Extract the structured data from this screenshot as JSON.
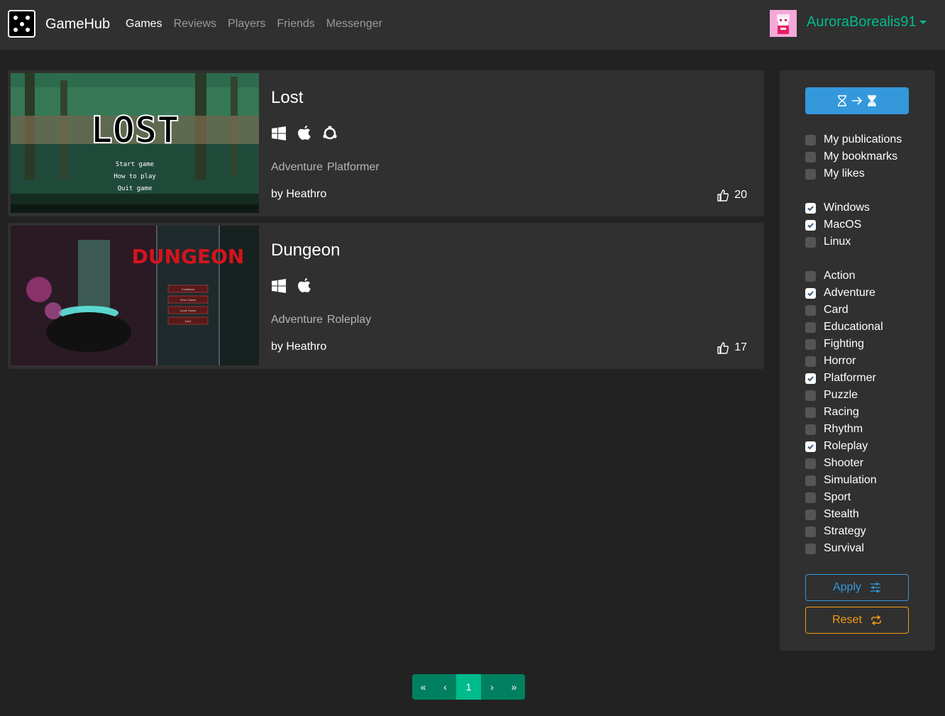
{
  "navbar": {
    "brand": "GameHub",
    "links": [
      {
        "label": "Games",
        "active": true
      },
      {
        "label": "Reviews",
        "active": false
      },
      {
        "label": "Players",
        "active": false
      },
      {
        "label": "Friends",
        "active": false
      },
      {
        "label": "Messenger",
        "active": false
      }
    ],
    "username": "AuroraBorealis91"
  },
  "games": [
    {
      "title": "Lost",
      "platforms": [
        "windows-icon",
        "apple-icon",
        "linux-icon"
      ],
      "tags": [
        "Adventure",
        "Platformer"
      ],
      "author": "by Heathro",
      "likes": "20",
      "thumb_text": "LOST",
      "thumb_menu": [
        "Start game",
        "How to play",
        "Quit game"
      ]
    },
    {
      "title": "Dungeon",
      "platforms": [
        "windows-icon",
        "apple-icon"
      ],
      "tags": [
        "Adventure",
        "Roleplay"
      ],
      "author": "by Heathro",
      "likes": "17",
      "thumb_text": "DUNGEON",
      "thumb_menu": [
        "Continue",
        "New Game",
        "Load Game",
        "Quit"
      ]
    }
  ],
  "sidebar": {
    "sort_icons": [
      "hourglass-empty-icon",
      "arrow-right-icon",
      "hourglass-full-icon"
    ],
    "personal": [
      {
        "label": "My publications",
        "checked": false
      },
      {
        "label": "My bookmarks",
        "checked": false
      },
      {
        "label": "My likes",
        "checked": false
      }
    ],
    "platforms": [
      {
        "label": "Windows",
        "checked": true
      },
      {
        "label": "MacOS",
        "checked": true
      },
      {
        "label": "Linux",
        "checked": false
      }
    ],
    "genres": [
      {
        "label": "Action",
        "checked": false
      },
      {
        "label": "Adventure",
        "checked": true
      },
      {
        "label": "Card",
        "checked": false
      },
      {
        "label": "Educational",
        "checked": false
      },
      {
        "label": "Fighting",
        "checked": false
      },
      {
        "label": "Horror",
        "checked": false
      },
      {
        "label": "Platformer",
        "checked": true
      },
      {
        "label": "Puzzle",
        "checked": false
      },
      {
        "label": "Racing",
        "checked": false
      },
      {
        "label": "Rhythm",
        "checked": false
      },
      {
        "label": "Roleplay",
        "checked": true
      },
      {
        "label": "Shooter",
        "checked": false
      },
      {
        "label": "Simulation",
        "checked": false
      },
      {
        "label": "Sport",
        "checked": false
      },
      {
        "label": "Stealth",
        "checked": false
      },
      {
        "label": "Strategy",
        "checked": false
      },
      {
        "label": "Survival",
        "checked": false
      }
    ],
    "apply_label": "Apply",
    "reset_label": "Reset"
  },
  "pagination": {
    "first": "«",
    "prev": "‹",
    "current": "1",
    "next": "›",
    "last": "»"
  },
  "colors": {
    "accent_green": "#00bc8c",
    "accent_blue": "#3498db",
    "accent_orange": "#f39c12",
    "background": "#222222",
    "panel": "#303030"
  }
}
